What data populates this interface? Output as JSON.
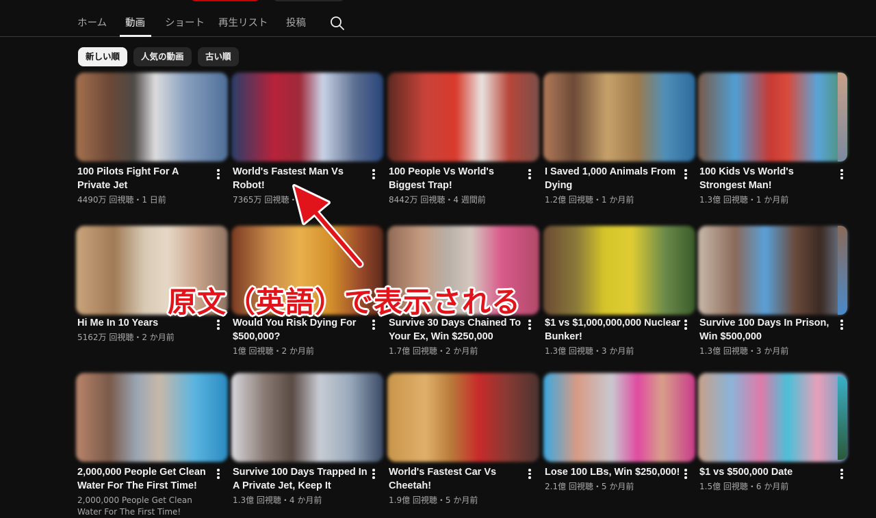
{
  "tabs": [
    {
      "label": "ホーム",
      "active": false
    },
    {
      "label": "動画",
      "active": true
    },
    {
      "label": "ショート",
      "active": false
    },
    {
      "label": "再生リスト",
      "active": false
    },
    {
      "label": "投稿",
      "active": false
    }
  ],
  "chips": [
    {
      "label": "新しい順",
      "selected": true
    },
    {
      "label": "人気の動画",
      "selected": false
    },
    {
      "label": "古い順",
      "selected": false
    }
  ],
  "videos": [
    {
      "title": "100 Pilots Fight For A Private Jet",
      "meta": "4490万 回視聴・1 日前"
    },
    {
      "title": "World's Fastest Man Vs Robot!",
      "meta": "7365万 回視聴・1 日前"
    },
    {
      "title": "100 People Vs World's Biggest Trap!",
      "meta": "8442万 回視聴・4 週間前"
    },
    {
      "title": "I Saved 1,000 Animals From Dying",
      "meta": "1.2億 回視聴・1 か月前"
    },
    {
      "title": "100 Kids Vs World's Strongest Man!",
      "meta": "1.3億 回視聴・1 か月前"
    },
    {
      "title": "Hi Me In 10 Years",
      "meta": "5162万 回視聴・2 か月前"
    },
    {
      "title": "Would You Risk Dying For $500,000?",
      "meta": "1億 回視聴・2 か月前"
    },
    {
      "title": "Survive 30 Days Chained To Your Ex, Win $250,000",
      "meta": "1.7億 回視聴・2 か月前"
    },
    {
      "title": "$1 vs $1,000,000,000 Nuclear Bunker!",
      "meta": "1.3億 回視聴・3 か月前"
    },
    {
      "title": "Survive 100 Days In Prison, Win $500,000",
      "meta": "1.3億 回視聴・3 か月前"
    },
    {
      "title": "2,000,000 People Get Clean Water For The First Time!",
      "meta": "2,000,000 People Get Clean Water For The First Time!"
    },
    {
      "title": "Survive 100 Days Trapped In A Private Jet, Keep It",
      "meta": "1.3億 回視聴・4 か月前"
    },
    {
      "title": "World's Fastest Car Vs Cheetah!",
      "meta": "1.9億 回視聴・5 か月前"
    },
    {
      "title": "Lose 100 LBs, Win $250,000!",
      "meta": "2.1億 回視聴・5 か月前"
    },
    {
      "title": "$1 vs $500,000 Date",
      "meta": "1.5億 回視聴・6 か月前"
    }
  ],
  "annotation": "原文（英語）で表示される",
  "colors": {
    "annotation": "#e1141b",
    "background": "#0f0f0f",
    "chip_selected": "#f1f1f1"
  }
}
